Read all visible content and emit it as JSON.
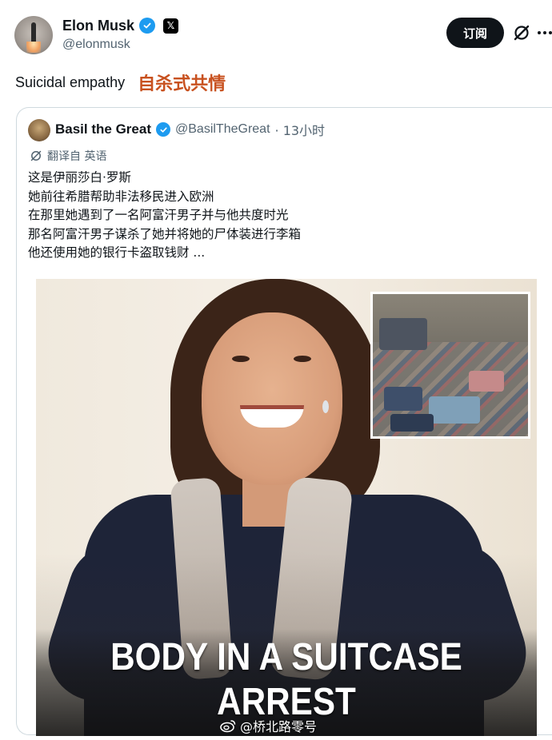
{
  "author": {
    "name": "Elon Musk",
    "handle": "@elonmusk",
    "x_badge": "𝕏",
    "verified_color": "#1d9bf0"
  },
  "actions": {
    "subscribe_label": "订阅",
    "grok_icon": "grok-icon",
    "more_icon": "more-icon"
  },
  "post": {
    "text_en": "Suicidal empathy",
    "text_zh": "自杀式共情"
  },
  "quote": {
    "name": "Basil the Great",
    "handle": "@BasilTheGreat",
    "time": "· 13小时",
    "translate_label": "翻译自 英语",
    "lines": [
      "这是伊丽莎白·罗斯",
      "她前往希腊帮助非法移民进入欧洲",
      "在那里她遇到了一名阿富汗男子并与他共度时光",
      "那名阿富汗男子谋杀了她并将她的尸体装进行李箱",
      "他还使用她的银行卡盗取钱财 ..."
    ],
    "image": {
      "headline_line1": "BODY IN A SUITCASE",
      "headline_line2": "ARREST"
    }
  },
  "watermark": {
    "text": "@桥北路零号"
  }
}
